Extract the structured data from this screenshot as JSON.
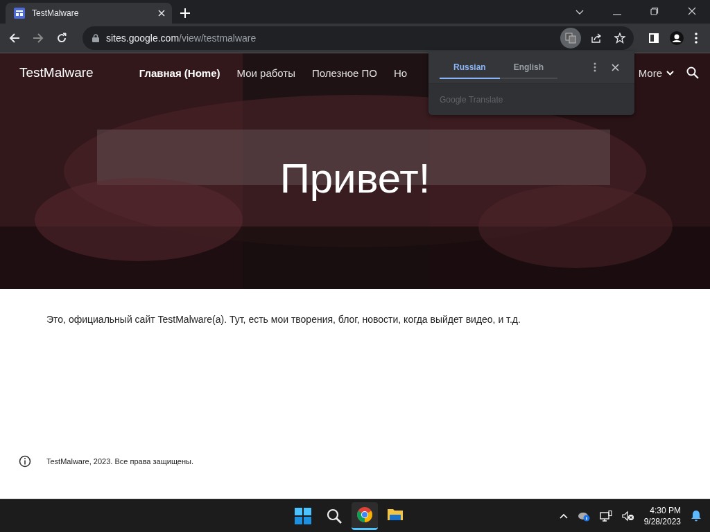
{
  "browser": {
    "tabs": [
      {
        "title": "TestMalware",
        "selected": true
      }
    ],
    "url": {
      "host": "sites.google.com",
      "path": "/view/testmalware"
    }
  },
  "site": {
    "title": "TestMalware",
    "nav": [
      {
        "label": "Главная (Home)",
        "selected": true
      },
      {
        "label": "Мои работы",
        "selected": false
      },
      {
        "label": "Полезное ПО",
        "selected": false
      },
      {
        "label": "Но",
        "selected": false
      }
    ],
    "more": "More"
  },
  "translate_popup": {
    "tabs": [
      {
        "label": "Russian",
        "selected": true
      },
      {
        "label": "English",
        "selected": false
      }
    ],
    "footer": "Google Translate"
  },
  "hero": {
    "heading": "Привет!"
  },
  "content": {
    "text": "Это, официальный сайт TestMalware(a). Тут, есть мои  творения, блог, новости, когда выйдет видео, и т.д."
  },
  "footer": {
    "text": "TestMalware, 2023. Все права защищены."
  },
  "taskbar": {
    "apps": [
      {
        "kind": "browser",
        "selected": true
      },
      {
        "kind": "folder",
        "selected": false
      }
    ],
    "time": "4:30 PM",
    "date": "9/28/2023"
  }
}
